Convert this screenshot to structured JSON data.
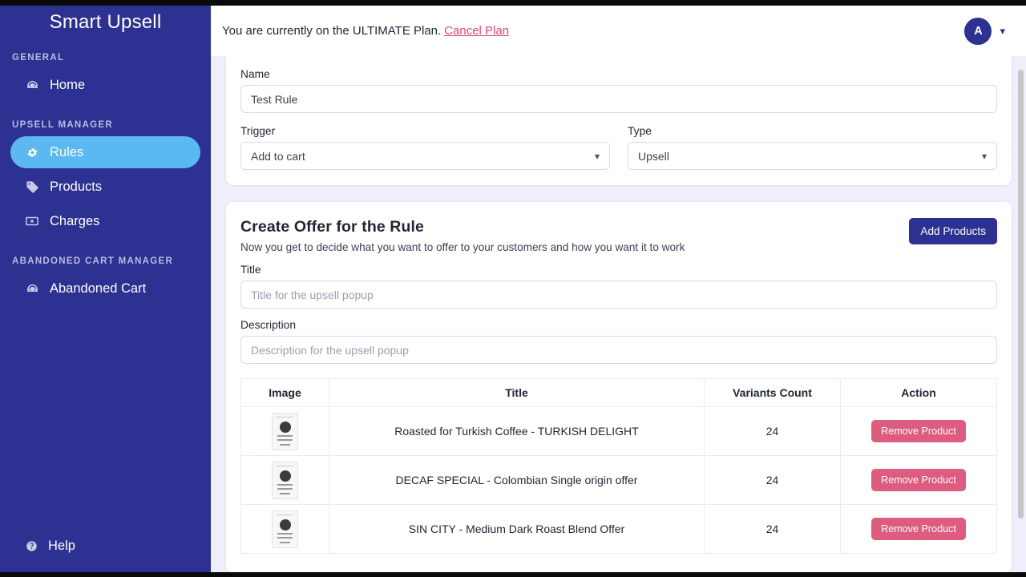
{
  "sidebar": {
    "brand": "Smart Upsell",
    "sections": [
      {
        "title": "GENERAL",
        "items": [
          {
            "label": "Home",
            "icon": "dashboard-icon",
            "active": false
          }
        ]
      },
      {
        "title": "UPSELL MANAGER",
        "items": [
          {
            "label": "Rules",
            "icon": "gear-icon",
            "active": true
          },
          {
            "label": "Products",
            "icon": "tag-icon",
            "active": false
          },
          {
            "label": "Charges",
            "icon": "banknote-icon",
            "active": false
          }
        ]
      },
      {
        "title": "ABANDONED CART MANAGER",
        "items": [
          {
            "label": "Abandoned Cart",
            "icon": "dashboard-icon",
            "active": false
          }
        ]
      }
    ],
    "help": {
      "label": "Help",
      "icon": "question-circle-icon"
    }
  },
  "topbar": {
    "plan_text": "You are currently on the ULTIMATE Plan.",
    "cancel_link": "Cancel Plan",
    "avatar_initial": "A",
    "caret_icon": "chevron-down-icon"
  },
  "rule_form": {
    "name_label": "Name",
    "name_value": "Test Rule",
    "name_placeholder": "Name",
    "trigger_label": "Trigger",
    "trigger_value": "Add to cart",
    "type_label": "Type",
    "type_value": "Upsell"
  },
  "offer": {
    "heading": "Create Offer for the Rule",
    "subheading": "Now you get to decide what you want to offer to your customers and how you want it to work",
    "add_products_label": "Add Products",
    "title_label": "Title",
    "title_placeholder": "Title for the upsell popup",
    "title_value": "",
    "description_label": "Description",
    "description_placeholder": "Description for the upsell popup",
    "description_value": ""
  },
  "table": {
    "headers": [
      "Image",
      "Title",
      "Variants Count",
      "Action"
    ],
    "rows": [
      {
        "image": "coffee-bag-thumbnail",
        "title": "Roasted for Turkish Coffee - TURKISH DELIGHT",
        "variants": "24",
        "action": "Remove Product"
      },
      {
        "image": "coffee-bag-thumbnail",
        "title": "DECAF SPECIAL - Colombian Single origin offer",
        "variants": "24",
        "action": "Remove Product"
      },
      {
        "image": "coffee-bag-thumbnail",
        "title": "SIN CITY - Medium Dark Roast Blend Offer",
        "variants": "24",
        "action": "Remove Product"
      }
    ]
  },
  "colors": {
    "sidebar_bg": "#2c3192",
    "active_nav": "#5cb8f0",
    "primary_button": "#2c3192",
    "danger_button": "#de5c7e",
    "link": "#e0457b",
    "content_bg": "#eeeffa"
  }
}
